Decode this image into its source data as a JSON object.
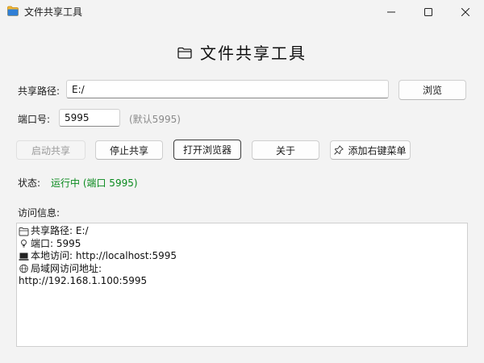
{
  "window": {
    "title": "文件共享工具"
  },
  "header": {
    "title": "文件共享工具",
    "icon": "folder-icon"
  },
  "share_path": {
    "label": "共享路径:",
    "value": "E:/",
    "browse_label": "浏览"
  },
  "port": {
    "label": "端口号:",
    "value": "5995",
    "hint": "(默认5995)"
  },
  "actions": {
    "start_label": "启动共享",
    "stop_label": "停止共享",
    "open_browser_label": "打开浏览器",
    "about_label": "关于",
    "context_menu_label": "添加右键菜单"
  },
  "status": {
    "label": "状态:",
    "value": "运行中 (端口 5995)"
  },
  "access_info": {
    "label": "访问信息:",
    "lines": [
      {
        "icon": "folder-icon",
        "text": "共享路径: E:/"
      },
      {
        "icon": "lightbulb-icon",
        "text": "端口: 5995"
      },
      {
        "icon": "computer-icon",
        "text": "本地访问: http://localhost:5995"
      },
      {
        "icon": "globe-icon",
        "text": "局域网访问地址:"
      },
      {
        "icon": "",
        "text": "http://192.168.1.100:5995"
      }
    ]
  },
  "colors": {
    "status_running": "#0a8a1e",
    "background": "#f3f3f3"
  }
}
